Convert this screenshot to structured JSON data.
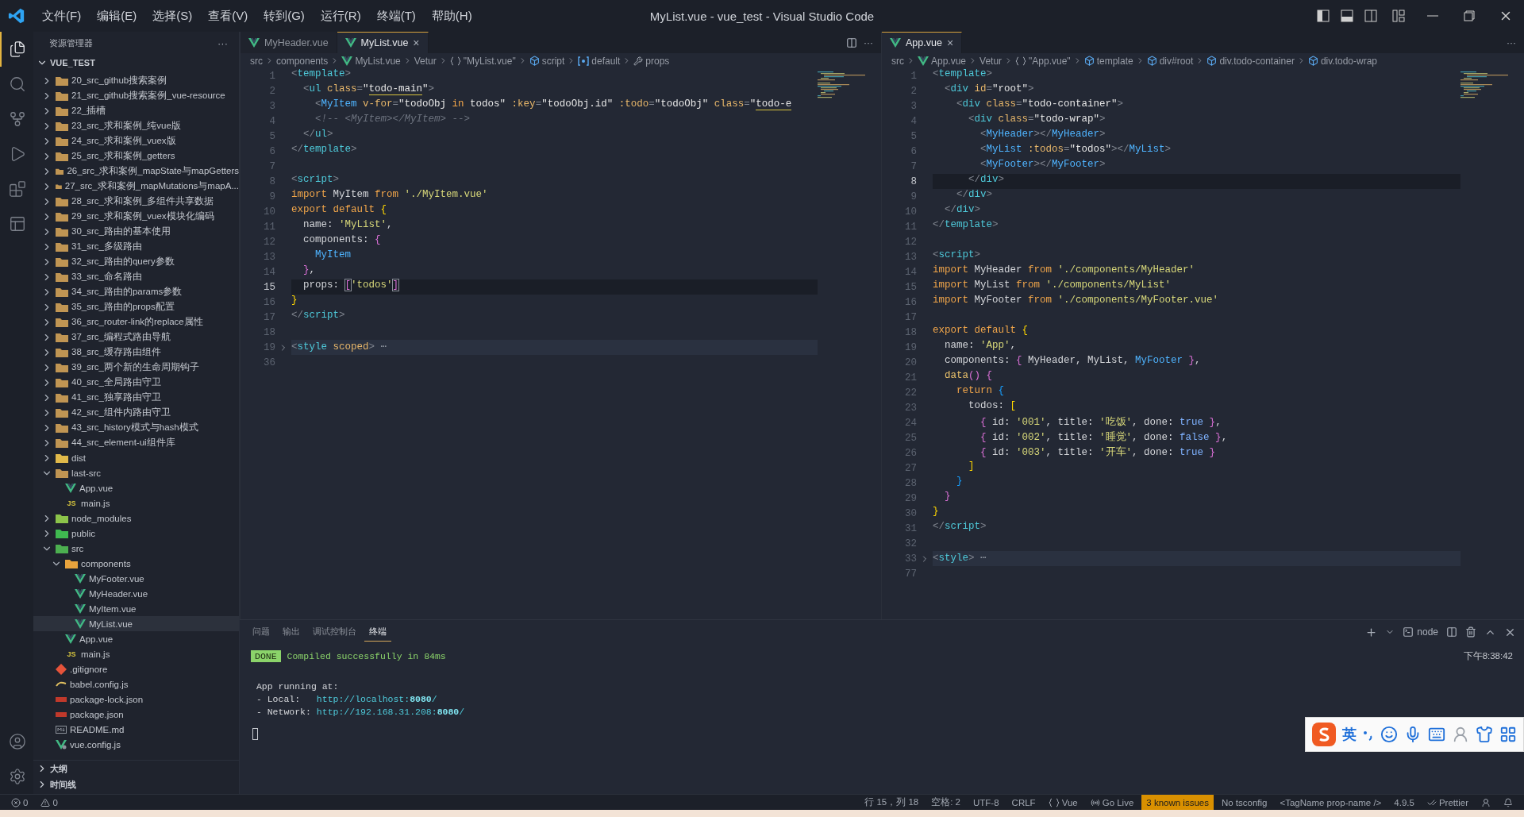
{
  "window": {
    "title": "MyList.vue - vue_test - Visual Studio Code",
    "menus": [
      "文件(F)",
      "编辑(E)",
      "选择(S)",
      "查看(V)",
      "转到(G)",
      "运行(R)",
      "终端(T)",
      "帮助(H)"
    ]
  },
  "activity_bar": [
    {
      "kind": "files",
      "selected": true
    },
    {
      "kind": "search",
      "selected": false
    },
    {
      "kind": "branch",
      "selected": false
    },
    {
      "kind": "run",
      "selected": false
    },
    {
      "kind": "extensions",
      "selected": false
    },
    {
      "kind": "preview",
      "selected": false
    }
  ],
  "sidebar": {
    "title": "资源管理器",
    "more": "···",
    "root": {
      "label": "VUE_TEST",
      "expanded": true
    },
    "items": [
      {
        "label": "20_src_github搜索案例",
        "kind": "folder",
        "expanded": false,
        "selected": false
      },
      {
        "label": "21_src_github搜索案例_vue-resource",
        "kind": "folder",
        "expanded": false,
        "selected": false
      },
      {
        "label": "22_插槽",
        "kind": "folder",
        "expanded": false,
        "selected": false
      },
      {
        "label": "23_src_求和案例_纯vue版",
        "kind": "folder",
        "expanded": false,
        "selected": false
      },
      {
        "label": "24_src_求和案例_vuex版",
        "kind": "folder",
        "expanded": false,
        "selected": false
      },
      {
        "label": "25_src_求和案例_getters",
        "kind": "folder",
        "expanded": false,
        "selected": false
      },
      {
        "label": "26_src_求和案例_mapState与mapGetters",
        "kind": "folder",
        "expanded": false,
        "selected": false
      },
      {
        "label": "27_src_求和案例_mapMutations与mapA...",
        "kind": "folder",
        "expanded": false,
        "selected": false
      },
      {
        "label": "28_src_求和案例_多组件共享数据",
        "kind": "folder",
        "expanded": false,
        "selected": false
      },
      {
        "label": "29_src_求和案例_vuex模块化编码",
        "kind": "folder",
        "expanded": false,
        "selected": false
      },
      {
        "label": "30_src_路由的基本使用",
        "kind": "folder",
        "expanded": false,
        "selected": false
      },
      {
        "label": "31_src_多级路由",
        "kind": "folder",
        "expanded": false,
        "selected": false
      },
      {
        "label": "32_src_路由的query参数",
        "kind": "folder",
        "expanded": false,
        "selected": false
      },
      {
        "label": "33_src_命名路由",
        "kind": "folder",
        "expanded": false,
        "selected": false
      },
      {
        "label": "34_src_路由的params参数",
        "kind": "folder",
        "expanded": false,
        "selected": false
      },
      {
        "label": "35_src_路由的props配置",
        "kind": "folder",
        "expanded": false,
        "selected": false
      },
      {
        "label": "36_src_router-link的replace属性",
        "kind": "folder",
        "expanded": false,
        "selected": false
      },
      {
        "label": "37_src_编程式路由导航",
        "kind": "folder",
        "expanded": false,
        "selected": false
      },
      {
        "label": "38_src_缓存路由组件",
        "kind": "folder",
        "expanded": false,
        "selected": false
      },
      {
        "label": "39_src_两个新的生命周期钩子",
        "kind": "folder",
        "expanded": false,
        "selected": false
      },
      {
        "label": "40_src_全局路由守卫",
        "kind": "folder",
        "expanded": false,
        "selected": false
      },
      {
        "label": "41_src_独享路由守卫",
        "kind": "folder",
        "expanded": false,
        "selected": false
      },
      {
        "label": "42_src_组件内路由守卫",
        "kind": "folder",
        "expanded": false,
        "selected": false
      },
      {
        "label": "43_src_history模式与hash模式",
        "kind": "folder",
        "expanded": false,
        "selected": false
      },
      {
        "label": "44_src_element-ui组件库",
        "kind": "folder",
        "expanded": false,
        "selected": false
      },
      {
        "label": "dist",
        "kind": "folder",
        "color": "#e0b94a",
        "expanded": false,
        "selected": false
      },
      {
        "label": "last-src",
        "kind": "folder",
        "expanded": true,
        "selected": false,
        "children": [
          {
            "label": "App.vue",
            "kind": "vue",
            "selected": false
          },
          {
            "label": "main.js",
            "kind": "js",
            "icon_text": "JS",
            "selected": false
          }
        ]
      },
      {
        "label": "node_modules",
        "kind": "folder",
        "color": "#8bc34a",
        "expanded": false,
        "selected": false
      },
      {
        "label": "public",
        "kind": "folder",
        "color": "#3fb950",
        "expanded": false,
        "selected": false
      },
      {
        "label": "src",
        "kind": "folder",
        "color": "#4caf50",
        "expanded": true,
        "selected": false,
        "children": [
          {
            "label": "components",
            "kind": "folder",
            "color": "#e8a33d",
            "expanded": true,
            "selected": false,
            "children": [
              {
                "label": "MyFooter.vue",
                "kind": "vue",
                "selected": false
              },
              {
                "label": "MyHeader.vue",
                "kind": "vue",
                "selected": false
              },
              {
                "label": "MyItem.vue",
                "kind": "vue",
                "selected": false
              },
              {
                "label": "MyList.vue",
                "kind": "vue",
                "selected": true
              }
            ]
          },
          {
            "label": "App.vue",
            "kind": "vue",
            "selected": false
          },
          {
            "label": "main.js",
            "kind": "js",
            "icon_text": "JS",
            "selected": false
          }
        ]
      },
      {
        "label": ".gitignore",
        "kind": "git",
        "selected": false
      },
      {
        "label": "babel.config.js",
        "kind": "babel",
        "selected": false
      },
      {
        "label": "package-lock.json",
        "kind": "json",
        "selected": false
      },
      {
        "label": "package.json",
        "kind": "json",
        "selected": false
      },
      {
        "label": "README.md",
        "kind": "md",
        "selected": false
      },
      {
        "label": "vue.config.js",
        "kind": "vueconfig",
        "selected": false
      }
    ],
    "sections": [
      {
        "label": "大纲",
        "expanded": false
      },
      {
        "label": "时间线",
        "expanded": false
      }
    ]
  },
  "editor_groups": [
    {
      "tabs": [
        {
          "label": "MyHeader.vue",
          "selected": false
        },
        {
          "label": "MyList.vue",
          "selected": true,
          "close": "×"
        }
      ],
      "actions": [
        {
          "kind": "split"
        },
        {
          "kind": "more",
          "text": "···"
        }
      ],
      "breadcrumbs": [
        {
          "kind": "plain",
          "text": "src"
        },
        {
          "kind": "plain",
          "text": "components"
        },
        {
          "kind": "vue",
          "text": "MyList.vue"
        },
        {
          "kind": "plain",
          "text": "Vetur"
        },
        {
          "kind": "braces",
          "text": "\"MyList.vue\""
        },
        {
          "kind": "element",
          "text": "script"
        },
        {
          "kind": "symbol",
          "text": "default"
        },
        {
          "kind": "property",
          "text": "props"
        }
      ],
      "lines": [
        {
          "n": "1",
          "kind": "plain",
          "tokens": [
            {
              "kind": "p",
              "text": "<"
            },
            {
              "kind": "tag",
              "text": "template"
            },
            {
              "kind": "p",
              "text": ">"
            }
          ]
        },
        {
          "n": "2",
          "kind": "plain",
          "tokens": [
            {
              "kind": "p",
              "text": "  <"
            },
            {
              "kind": "tag",
              "text": "ul"
            },
            {
              "kind": "attr",
              "text": " class"
            },
            {
              "kind": "p",
              "text": "="
            },
            {
              "kind": "val",
              "text": "\""
            },
            {
              "kind": "valu",
              "text": "todo-main"
            },
            {
              "kind": "val",
              "text": "\""
            },
            {
              "kind": "p",
              "text": ">"
            }
          ]
        },
        {
          "n": "3",
          "kind": "plain",
          "tokens": [
            {
              "kind": "p",
              "text": "    <"
            },
            {
              "kind": "comp",
              "text": "MyItem"
            },
            {
              "kind": "attr",
              "text": " v-for"
            },
            {
              "kind": "p",
              "text": "="
            },
            {
              "kind": "val",
              "text": "\"todoObj "
            },
            {
              "kind": "kw",
              "text": "in"
            },
            {
              "kind": "val",
              "text": " todos\""
            },
            {
              "kind": "attr",
              "text": " :key"
            },
            {
              "kind": "p",
              "text": "="
            },
            {
              "kind": "val",
              "text": "\"todoObj.id\""
            },
            {
              "kind": "attr",
              "text": " :todo"
            },
            {
              "kind": "p",
              "text": "="
            },
            {
              "kind": "val",
              "text": "\"todoObj\""
            },
            {
              "kind": "attr",
              "text": " class"
            },
            {
              "kind": "p",
              "text": "="
            },
            {
              "kind": "val",
              "text": "\""
            },
            {
              "kind": "valu",
              "text": "todo-e"
            }
          ]
        },
        {
          "n": "4",
          "kind": "plain",
          "tokens": [
            {
              "kind": "cmt",
              "text": "    <!-- <MyItem></MyItem> -->"
            }
          ]
        },
        {
          "n": "5",
          "kind": "plain",
          "tokens": [
            {
              "kind": "p",
              "text": "  </"
            },
            {
              "kind": "tag",
              "text": "ul"
            },
            {
              "kind": "p",
              "text": ">"
            }
          ]
        },
        {
          "n": "6",
          "kind": "plain",
          "tokens": [
            {
              "kind": "p",
              "text": "</"
            },
            {
              "kind": "tag",
              "text": "template"
            },
            {
              "kind": "p",
              "text": ">"
            }
          ]
        },
        {
          "n": "7",
          "kind": "plain"
        },
        {
          "n": "8",
          "kind": "plain",
          "tokens": [
            {
              "kind": "p",
              "text": "<"
            },
            {
              "kind": "tag",
              "text": "script"
            },
            {
              "kind": "p",
              "text": ">"
            }
          ]
        },
        {
          "n": "9",
          "kind": "plain",
          "tokens": [
            {
              "kind": "kw",
              "text": "import"
            },
            {
              "kind": "txt",
              "text": " MyItem "
            },
            {
              "kind": "kw",
              "text": "from"
            },
            {
              "kind": "str",
              "text": " './MyItem.vue'"
            }
          ]
        },
        {
          "n": "10",
          "kind": "plain",
          "tokens": [
            {
              "kind": "kw",
              "text": "export default"
            },
            {
              "kind": "b1",
              "text": " {"
            }
          ]
        },
        {
          "n": "11",
          "kind": "plain",
          "tokens": [
            {
              "kind": "txt",
              "text": "  name: "
            },
            {
              "kind": "str",
              "text": "'MyList'"
            },
            {
              "kind": "txt",
              "text": ","
            }
          ]
        },
        {
          "n": "12",
          "kind": "plain",
          "tokens": [
            {
              "kind": "txt",
              "text": "  components: "
            },
            {
              "kind": "b2",
              "text": "{"
            }
          ]
        },
        {
          "n": "13",
          "kind": "plain",
          "tokens": [
            {
              "kind": "comp",
              "text": "    MyItem"
            }
          ]
        },
        {
          "n": "14",
          "kind": "plain",
          "tokens": [
            {
              "kind": "b2",
              "text": "  }"
            },
            {
              "kind": "txt",
              "text": ","
            }
          ]
        },
        {
          "n": "15",
          "kind": "current",
          "tokens": [
            {
              "kind": "txt",
              "text": "  props: "
            },
            {
              "kind": "bm",
              "text": "["
            },
            {
              "kind": "str",
              "text": "'todos'"
            },
            {
              "kind": "bm",
              "text": "]"
            }
          ]
        },
        {
          "n": "16",
          "kind": "plain",
          "tokens": [
            {
              "kind": "b1",
              "text": "}"
            }
          ]
        },
        {
          "n": "17",
          "kind": "plain",
          "tokens": [
            {
              "kind": "p",
              "text": "</"
            },
            {
              "kind": "tag",
              "text": "script"
            },
            {
              "kind": "p",
              "text": ">"
            }
          ]
        },
        {
          "n": "18",
          "kind": "plain"
        },
        {
          "n": "19",
          "kind": "folded",
          "tokens": [
            {
              "kind": "p",
              "text": "<"
            },
            {
              "kind": "tag",
              "text": "style"
            },
            {
              "kind": "attr",
              "text": " scoped"
            },
            {
              "kind": "p",
              "text": ">"
            },
            {
              "kind": "fold",
              "text": " ⋯"
            }
          ]
        },
        {
          "n": "36",
          "kind": "plain"
        }
      ]
    },
    {
      "tabs": [
        {
          "label": "App.vue",
          "selected": true,
          "close": "×"
        }
      ],
      "actions": [
        {
          "kind": "more",
          "text": "···"
        }
      ],
      "breadcrumbs": [
        {
          "kind": "plain",
          "text": "src"
        },
        {
          "kind": "vue",
          "text": "App.vue"
        },
        {
          "kind": "plain",
          "text": "Vetur"
        },
        {
          "kind": "braces",
          "text": "\"App.vue\""
        },
        {
          "kind": "element",
          "text": "template"
        },
        {
          "kind": "element",
          "text": "div#root"
        },
        {
          "kind": "element",
          "text": "div.todo-container"
        },
        {
          "kind": "element",
          "text": "div.todo-wrap"
        }
      ],
      "lines": [
        {
          "n": "1",
          "kind": "plain",
          "tokens": [
            {
              "kind": "p",
              "text": "<"
            },
            {
              "kind": "tag",
              "text": "template"
            },
            {
              "kind": "p",
              "text": ">"
            }
          ]
        },
        {
          "n": "2",
          "kind": "plain",
          "tokens": [
            {
              "kind": "p",
              "text": "  <"
            },
            {
              "kind": "tag",
              "text": "div"
            },
            {
              "kind": "attr",
              "text": " id"
            },
            {
              "kind": "p",
              "text": "="
            },
            {
              "kind": "val",
              "text": "\"root\""
            },
            {
              "kind": "p",
              "text": ">"
            }
          ]
        },
        {
          "n": "3",
          "kind": "plain",
          "tokens": [
            {
              "kind": "p",
              "text": "    <"
            },
            {
              "kind": "tag",
              "text": "div"
            },
            {
              "kind": "attr",
              "text": " class"
            },
            {
              "kind": "p",
              "text": "="
            },
            {
              "kind": "val",
              "text": "\"todo-container\""
            },
            {
              "kind": "p",
              "text": ">"
            }
          ]
        },
        {
          "n": "4",
          "kind": "plain",
          "tokens": [
            {
              "kind": "p",
              "text": "      <"
            },
            {
              "kind": "tag",
              "text": "div"
            },
            {
              "kind": "attr",
              "text": " class"
            },
            {
              "kind": "p",
              "text": "="
            },
            {
              "kind": "val",
              "text": "\"todo-wrap\""
            },
            {
              "kind": "p",
              "text": ">"
            }
          ]
        },
        {
          "n": "5",
          "kind": "plain",
          "tokens": [
            {
              "kind": "p",
              "text": "        <"
            },
            {
              "kind": "comp",
              "text": "MyHeader"
            },
            {
              "kind": "p",
              "text": "></"
            },
            {
              "kind": "comp",
              "text": "MyHeader"
            },
            {
              "kind": "p",
              "text": ">"
            }
          ]
        },
        {
          "n": "6",
          "kind": "plain",
          "tokens": [
            {
              "kind": "p",
              "text": "        <"
            },
            {
              "kind": "comp",
              "text": "MyList"
            },
            {
              "kind": "attr",
              "text": " :todos"
            },
            {
              "kind": "p",
              "text": "="
            },
            {
              "kind": "val",
              "text": "\"todos\""
            },
            {
              "kind": "p",
              "text": "></"
            },
            {
              "kind": "comp",
              "text": "MyList"
            },
            {
              "kind": "p",
              "text": ">"
            }
          ]
        },
        {
          "n": "7",
          "kind": "plain",
          "tokens": [
            {
              "kind": "p",
              "text": "        <"
            },
            {
              "kind": "comp",
              "text": "MyFooter"
            },
            {
              "kind": "p",
              "text": "></"
            },
            {
              "kind": "comp",
              "text": "MyFooter"
            },
            {
              "kind": "p",
              "text": ">"
            }
          ]
        },
        {
          "n": "8",
          "kind": "current",
          "tokens": [
            {
              "kind": "p",
              "text": "      </"
            },
            {
              "kind": "tag",
              "text": "div"
            },
            {
              "kind": "p",
              "text": ">"
            }
          ]
        },
        {
          "n": "9",
          "kind": "plain",
          "tokens": [
            {
              "kind": "p",
              "text": "    </"
            },
            {
              "kind": "tag",
              "text": "div"
            },
            {
              "kind": "p",
              "text": ">"
            }
          ]
        },
        {
          "n": "10",
          "kind": "plain",
          "tokens": [
            {
              "kind": "p",
              "text": "  </"
            },
            {
              "kind": "tag",
              "text": "div"
            },
            {
              "kind": "p",
              "text": ">"
            }
          ]
        },
        {
          "n": "11",
          "kind": "plain",
          "tokens": [
            {
              "kind": "p",
              "text": "</"
            },
            {
              "kind": "tag",
              "text": "template"
            },
            {
              "kind": "p",
              "text": ">"
            }
          ]
        },
        {
          "n": "12",
          "kind": "plain"
        },
        {
          "n": "13",
          "kind": "plain",
          "tokens": [
            {
              "kind": "p",
              "text": "<"
            },
            {
              "kind": "tag",
              "text": "script"
            },
            {
              "kind": "p",
              "text": ">"
            }
          ]
        },
        {
          "n": "14",
          "kind": "plain",
          "tokens": [
            {
              "kind": "kw",
              "text": "import"
            },
            {
              "kind": "txt",
              "text": " MyHeader "
            },
            {
              "kind": "kw",
              "text": "from"
            },
            {
              "kind": "str",
              "text": " './components/MyHeader'"
            }
          ]
        },
        {
          "n": "15",
          "kind": "plain",
          "tokens": [
            {
              "kind": "kw",
              "text": "import"
            },
            {
              "kind": "txt",
              "text": " MyList "
            },
            {
              "kind": "kw",
              "text": "from"
            },
            {
              "kind": "str",
              "text": " './components/MyList'"
            }
          ]
        },
        {
          "n": "16",
          "kind": "plain",
          "tokens": [
            {
              "kind": "kw",
              "text": "import"
            },
            {
              "kind": "txt",
              "text": " MyFooter "
            },
            {
              "kind": "kw",
              "text": "from"
            },
            {
              "kind": "str",
              "text": " './components/MyFooter.vue'"
            }
          ]
        },
        {
          "n": "17",
          "kind": "plain"
        },
        {
          "n": "18",
          "kind": "plain",
          "tokens": [
            {
              "kind": "kw",
              "text": "export default"
            },
            {
              "kind": "b1",
              "text": " {"
            }
          ]
        },
        {
          "n": "19",
          "kind": "plain",
          "tokens": [
            {
              "kind": "txt",
              "text": "  name: "
            },
            {
              "kind": "str",
              "text": "'App'"
            },
            {
              "kind": "txt",
              "text": ","
            }
          ]
        },
        {
          "n": "20",
          "kind": "plain",
          "tokens": [
            {
              "kind": "txt",
              "text": "  components: "
            },
            {
              "kind": "b2",
              "text": "{"
            },
            {
              "kind": "txt",
              "text": " MyHeader, MyList, "
            },
            {
              "kind": "comp",
              "text": "MyFooter"
            },
            {
              "kind": "b2",
              "text": " }"
            },
            {
              "kind": "txt",
              "text": ","
            }
          ]
        },
        {
          "n": "21",
          "kind": "plain",
          "tokens": [
            {
              "kind": "fn",
              "text": "  data"
            },
            {
              "kind": "b2",
              "text": "() {"
            }
          ]
        },
        {
          "n": "22",
          "kind": "plain",
          "tokens": [
            {
              "kind": "kw",
              "text": "    return"
            },
            {
              "kind": "b3",
              "text": " {"
            }
          ]
        },
        {
          "n": "23",
          "kind": "plain",
          "tokens": [
            {
              "kind": "txt",
              "text": "      todos: "
            },
            {
              "kind": "b1",
              "text": "["
            }
          ]
        },
        {
          "n": "24",
          "kind": "plain",
          "tokens": [
            {
              "kind": "b2",
              "text": "        {"
            },
            {
              "kind": "txt",
              "text": " id: "
            },
            {
              "kind": "str",
              "text": "'001'"
            },
            {
              "kind": "txt",
              "text": ", title: "
            },
            {
              "kind": "str",
              "text": "'吃饭'"
            },
            {
              "kind": "txt",
              "text": ", done: "
            },
            {
              "kind": "bool",
              "text": "true"
            },
            {
              "kind": "b2",
              "text": " }"
            },
            {
              "kind": "txt",
              "text": ","
            }
          ]
        },
        {
          "n": "25",
          "kind": "plain",
          "tokens": [
            {
              "kind": "b2",
              "text": "        {"
            },
            {
              "kind": "txt",
              "text": " id: "
            },
            {
              "kind": "str",
              "text": "'002'"
            },
            {
              "kind": "txt",
              "text": ", title: "
            },
            {
              "kind": "str",
              "text": "'睡觉'"
            },
            {
              "kind": "txt",
              "text": ", done: "
            },
            {
              "kind": "bool",
              "text": "false"
            },
            {
              "kind": "b2",
              "text": " }"
            },
            {
              "kind": "txt",
              "text": ","
            }
          ]
        },
        {
          "n": "26",
          "kind": "plain",
          "tokens": [
            {
              "kind": "b2",
              "text": "        {"
            },
            {
              "kind": "txt",
              "text": " id: "
            },
            {
              "kind": "str",
              "text": "'003'"
            },
            {
              "kind": "txt",
              "text": ", title: "
            },
            {
              "kind": "str",
              "text": "'开车'"
            },
            {
              "kind": "txt",
              "text": ", done: "
            },
            {
              "kind": "bool",
              "text": "true"
            },
            {
              "kind": "b2",
              "text": " }"
            }
          ]
        },
        {
          "n": "27",
          "kind": "plain",
          "tokens": [
            {
              "kind": "b1",
              "text": "      ]"
            }
          ]
        },
        {
          "n": "28",
          "kind": "plain",
          "tokens": [
            {
              "kind": "b3",
              "text": "    }"
            }
          ]
        },
        {
          "n": "29",
          "kind": "plain",
          "tokens": [
            {
              "kind": "b2",
              "text": "  }"
            }
          ]
        },
        {
          "n": "30",
          "kind": "plain",
          "tokens": [
            {
              "kind": "b1",
              "text": "}"
            }
          ]
        },
        {
          "n": "31",
          "kind": "plain",
          "tokens": [
            {
              "kind": "p",
              "text": "</"
            },
            {
              "kind": "tag",
              "text": "script"
            },
            {
              "kind": "p",
              "text": ">"
            }
          ]
        },
        {
          "n": "32",
          "kind": "plain"
        },
        {
          "n": "33",
          "kind": "folded",
          "tokens": [
            {
              "kind": "p",
              "text": "<"
            },
            {
              "kind": "tag",
              "text": "style"
            },
            {
              "kind": "p",
              "text": ">"
            },
            {
              "kind": "fold",
              "text": " ⋯"
            }
          ]
        },
        {
          "n": "77",
          "kind": "plain"
        }
      ]
    }
  ],
  "panel": {
    "tabs": [
      {
        "label": "问题",
        "selected": false
      },
      {
        "label": "输出",
        "selected": false
      },
      {
        "label": "调试控制台",
        "selected": false
      },
      {
        "label": "终端",
        "selected": true
      }
    ],
    "actions": [
      {
        "kind": "plus"
      },
      {
        "kind": "caret"
      },
      {
        "kind": "terminal",
        "text": "node"
      },
      {
        "kind": "split"
      },
      {
        "kind": "trash"
      },
      {
        "kind": "maximize"
      },
      {
        "kind": "close"
      }
    ],
    "status_badge": "DONE",
    "status_text": "Compiled successfully in 84ms",
    "timestamp": "下午8:38:42",
    "lines": [
      {
        "tokens": [
          {
            "kind": "txt",
            "text": " App running at:"
          }
        ]
      },
      {
        "tokens": [
          {
            "kind": "txt",
            "text": " - Local:   "
          },
          {
            "kind": "url",
            "text": "http://localhost:"
          },
          {
            "kind": "urlb",
            "text": "8080"
          },
          {
            "kind": "url",
            "text": "/"
          }
        ]
      },
      {
        "tokens": [
          {
            "kind": "txt",
            "text": " - Network: "
          },
          {
            "kind": "url",
            "text": "http://192.168.31.208:"
          },
          {
            "kind": "urlb",
            "text": "8080"
          },
          {
            "kind": "url",
            "text": "/"
          }
        ]
      }
    ]
  },
  "ime_bar": {
    "mode": "英"
  },
  "status_bar": {
    "left": [
      {
        "kind": "errors",
        "text": "0"
      },
      {
        "kind": "warnings",
        "text": "0"
      }
    ],
    "right": [
      {
        "kind": "text",
        "text": "行 15，列 18"
      },
      {
        "kind": "text",
        "text": "空格: 2"
      },
      {
        "kind": "text",
        "text": "UTF-8"
      },
      {
        "kind": "text",
        "text": "CRLF"
      },
      {
        "kind": "braces",
        "text": "Vue"
      },
      {
        "kind": "live",
        "text": "Go Live"
      },
      {
        "kind": "alert",
        "text": "3 known issues"
      },
      {
        "kind": "text",
        "text": "No tsconfig"
      },
      {
        "kind": "text",
        "text": "<TagName prop-name />"
      },
      {
        "kind": "text",
        "text": "4.9.5"
      },
      {
        "kind": "check",
        "text": "Prettier"
      },
      {
        "kind": "feedback"
      },
      {
        "kind": "bell"
      }
    ]
  }
}
